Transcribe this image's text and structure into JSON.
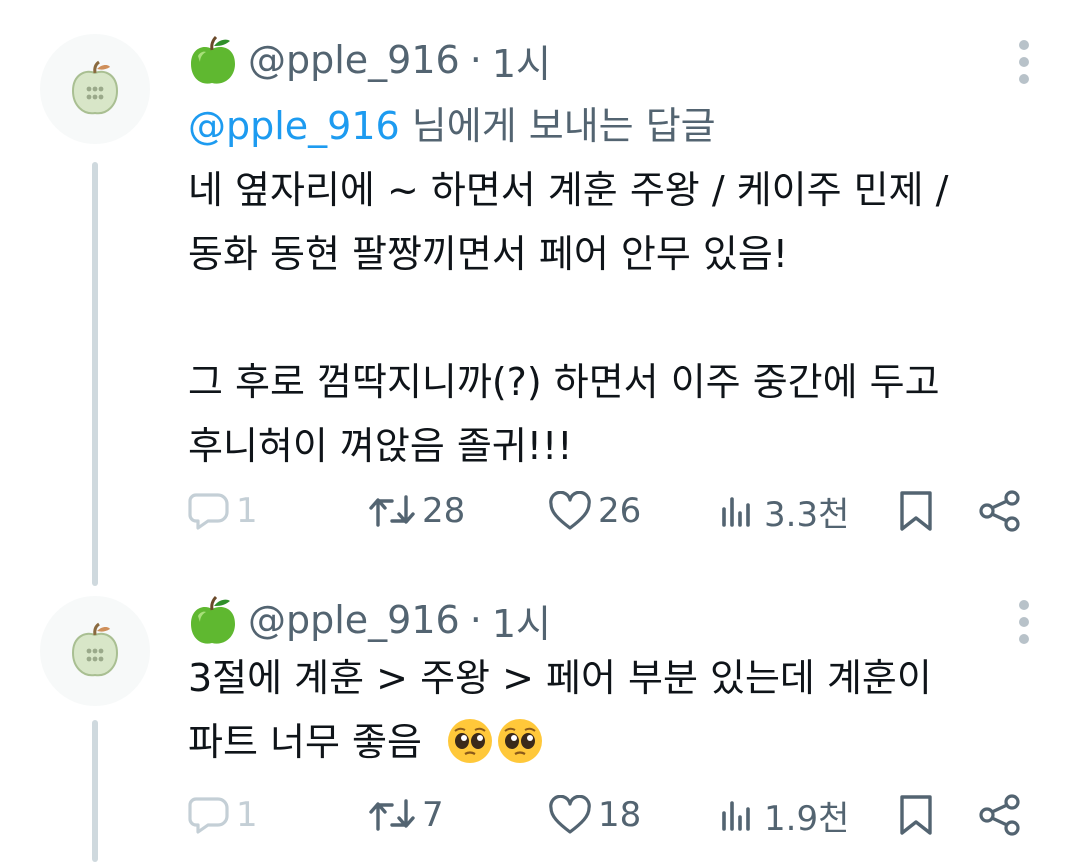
{
  "tweets": [
    {
      "user_name": "@pple_916",
      "separator": "·",
      "time": "1시",
      "reply_mention": "@pple_916",
      "reply_suffix": " 님에게 보내는 답글",
      "lines": [
        "네 옆자리에 ~ 하면서 계훈 주왕 / 케이주 민제 /",
        "동화 동현 팔짱끼면서 페어 안무 있음!",
        "",
        "그 후로 껌딱지니까(?) 하면서 이주 중간에 두고",
        "후니혀이 껴앉음 졸귀!!!"
      ],
      "stats": {
        "replies": "1",
        "retweets": "28",
        "likes": "26",
        "views": "3.3천"
      }
    },
    {
      "user_name": "@pple_916",
      "separator": "·",
      "time": "1시",
      "lines": [
        "3절에 계훈 > 주왕 > 페어 부분 있는데 계훈이",
        "파트 너무 좋음"
      ],
      "emojis": [
        "pleading-face-emoji",
        "pleading-face-emoji"
      ],
      "stats": {
        "replies": "1",
        "retweets": "7",
        "likes": "18",
        "views": "1.9천"
      }
    }
  ],
  "icons": {
    "name_emoji": "green-apple-emoji",
    "avatar": "apple-avatar",
    "reply": "reply-icon",
    "retweet": "retweet-icon",
    "like": "heart-icon",
    "views": "views-icon",
    "bookmark": "bookmark-icon",
    "share": "share-icon",
    "more": "more-icon"
  },
  "colors": {
    "text": "#0f1419",
    "secondary": "#536471",
    "mention": "#1d9bf0",
    "thread_line": "#cfd9de",
    "faint": "#c4cfd6"
  }
}
